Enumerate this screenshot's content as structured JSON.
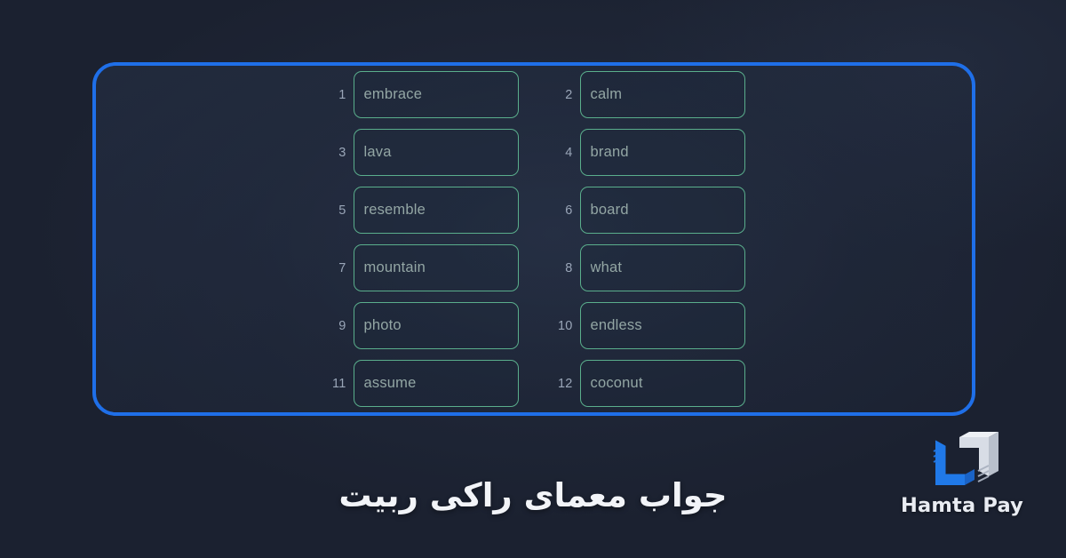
{
  "background": {
    "color": "#1b2130",
    "accent_blue": "#1f6fe8",
    "box_border_green": "#5aae8c",
    "word_text_color": "#93a6a4",
    "index_text_color": "#9aa6b8"
  },
  "panel": {
    "rows": [
      [
        {
          "index": "1",
          "word": "embrace"
        },
        {
          "index": "2",
          "word": "calm"
        }
      ],
      [
        {
          "index": "3",
          "word": "lava"
        },
        {
          "index": "4",
          "word": "brand"
        }
      ],
      [
        {
          "index": "5",
          "word": "resemble"
        },
        {
          "index": "6",
          "word": "board"
        }
      ],
      [
        {
          "index": "7",
          "word": "mountain"
        },
        {
          "index": "8",
          "word": "what"
        }
      ],
      [
        {
          "index": "9",
          "word": "photo"
        },
        {
          "index": "10",
          "word": "endless"
        }
      ],
      [
        {
          "index": "11",
          "word": "assume"
        },
        {
          "index": "12",
          "word": "coconut"
        }
      ]
    ]
  },
  "caption": {
    "text": "جواب معمای راکی ربیت"
  },
  "logo": {
    "mark_name": "hamta-pay-logo-mark",
    "text": "Hamta Pay",
    "mark_blue": "#2079e8",
    "mark_white": "#d8dde6"
  }
}
